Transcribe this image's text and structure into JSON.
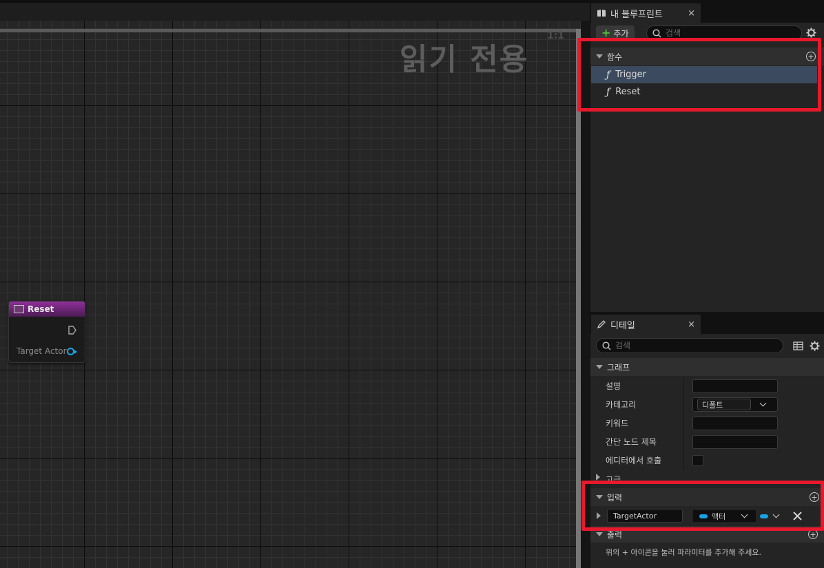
{
  "graph": {
    "readonly_label": "읽기 전용",
    "zoom_label": "1:1"
  },
  "node": {
    "title": "Reset",
    "pin_label": "Target Actor",
    "header_color": "#8f2f9a",
    "pin_color": "#18a3e6"
  },
  "my_blueprint": {
    "tab_title": "내 블루프린트",
    "close": "×",
    "add_label": "추가",
    "search_placeholder": "검색",
    "functions_header": "함수",
    "functions": [
      {
        "label": "Trigger",
        "selected": true
      },
      {
        "label": "Reset",
        "selected": false
      }
    ]
  },
  "details": {
    "tab_title": "디테일",
    "close": "×",
    "search_placeholder": "검색",
    "graph_section": "그래프",
    "rows": {
      "description": "설명",
      "category": "카테고리",
      "category_value": "디폴트",
      "keywords": "키워드",
      "compact_title": "간단 노드 제목",
      "call_in_editor": "에디터에서 호출"
    },
    "advanced": "고급",
    "inputs_section": "입력",
    "input_param": {
      "name": "TargetActor",
      "type": "액터",
      "type_color": "#18a3e6"
    },
    "outputs_section": "출력",
    "outputs_hint": "위의 + 아이콘을 눌러 파라미터를 추가해 주세요."
  },
  "highlight_color": "#e8192c"
}
